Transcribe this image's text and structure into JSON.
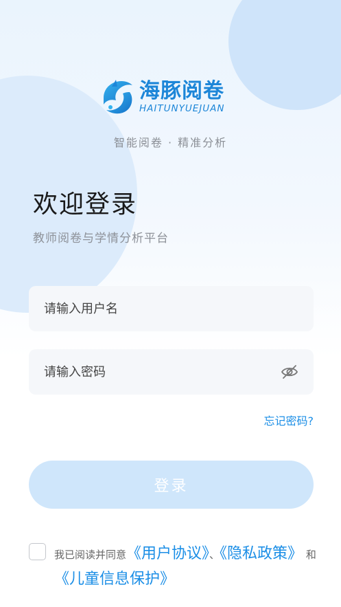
{
  "brand": {
    "name_cn": "海豚阅卷",
    "name_en": "HAITUNYUEJUAN",
    "slogan": "智能阅卷 · 精准分析",
    "color": "#1d86d8"
  },
  "header": {
    "title": "欢迎登录",
    "subtitle": "教师阅卷与学情分析平台"
  },
  "form": {
    "username_placeholder": "请输入用户名",
    "username_value": "",
    "password_placeholder": "请输入密码",
    "password_value": "",
    "password_toggle_icon": "eye-off-icon",
    "forgot_label": "忘记密码?",
    "login_label": "登录"
  },
  "agreement": {
    "checked": false,
    "prefix": "我已阅读并同意",
    "user_agreement": "《用户协议》",
    "separator": "、",
    "privacy_policy": "《隐私政策》",
    "conjunction": "和",
    "child_protection": "《儿童信息保护》"
  },
  "colors": {
    "accent": "#1b8ee6",
    "button_disabled": "#cfe6fb",
    "background_tint": "#eaf4fd"
  }
}
